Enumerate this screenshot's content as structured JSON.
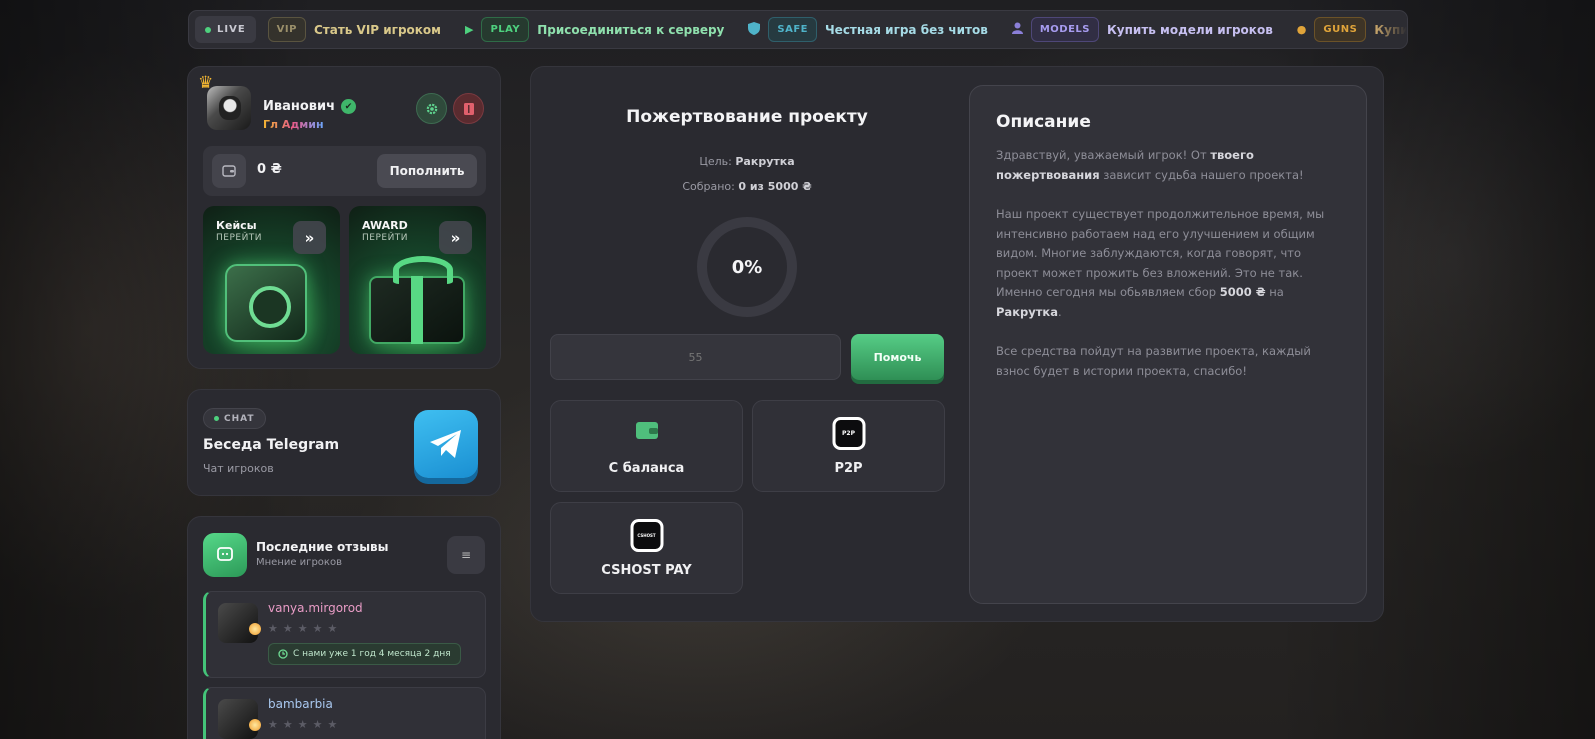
{
  "ticker": {
    "live": "LIVE",
    "items": [
      {
        "tag": "VIP",
        "text": "Стать VIP игроком",
        "tag_color": "#9a8f6a",
        "icon": "none"
      },
      {
        "tag": "PLAY",
        "text": "Присоединиться к серверу",
        "tag_color": "#4ed17e",
        "icon": "play-icon"
      },
      {
        "tag": "SAFE",
        "text": "Честная игра без читов",
        "tag_color": "#4fb3c9",
        "icon": "shield-icon"
      },
      {
        "tag": "MODELS",
        "text": "Купить модели игроков",
        "tag_color": "#8b7fd8",
        "icon": "user-icon"
      },
      {
        "tag": "GUNS",
        "text": "Купить модели оружия",
        "tag_color": "#e0a43a",
        "icon": "gun-icon"
      }
    ]
  },
  "profile": {
    "name": "Иванович",
    "role": "Гл Админ",
    "balance": "0 ₴",
    "topup_label": "Пополнить",
    "cases": {
      "title": "Кейсы",
      "sub": "ПЕРЕЙТИ"
    },
    "award": {
      "title": "AWARD",
      "sub": "ПЕРЕЙТИ"
    }
  },
  "telegram": {
    "pill": "CHAT",
    "title": "Беседа Telegram",
    "sub": "Чат игроков"
  },
  "reviews": {
    "title": "Последние отзывы",
    "sub": "Мнение игроков",
    "items": [
      {
        "name": "vanya.mirgorod",
        "stars": "★★★★★",
        "since": "С нами уже 1 год 4 месяца 2 дня",
        "name_color": "#e99cc6"
      },
      {
        "name": "bambarbia",
        "stars": "★★★★★",
        "since": "",
        "name_color": "#a9c8f0"
      }
    ]
  },
  "donate": {
    "title": "Пожертвование проекту",
    "goal_label": "Цель:",
    "goal_value": "Ракрутка",
    "collected_label": "Собрано:",
    "collected_value": "0 из 5000 ₴",
    "percent": "0%",
    "progress": 0,
    "amount_placeholder": "55",
    "help_label": "Помочь",
    "methods": [
      {
        "label": "С баланса",
        "icon": "wallet-icon"
      },
      {
        "label": "P2P",
        "icon": "p2p-logo"
      },
      {
        "label": "CSHOST PAY",
        "icon": "cshost-logo"
      }
    ],
    "p2p_logo_text": "P2P",
    "cshost_logo_text": "CSHOST"
  },
  "description": {
    "title": "Описание",
    "p1_a": "Здравствуй, уважаемый игрок! От ",
    "p1_b": "твоего пожертвования",
    "p1_c": " зависит судьба нашего проекта!",
    "p2_a": "Наш проект существует продолжительное время, мы интенсивно работаем над его улучшением и общим видом. Многие заблуждаются, когда говорят, что проект может прожить без вложений. Это не так. Именно сегодня мы обьявляем сбор ",
    "p2_b": "5000 ₴",
    "p2_c": " на ",
    "p2_d": "Ракрутка",
    "p2_e": ".",
    "p3": "Все средства пойдут на развитие проекта, каждый взнос будет в истории проекта, спасибо!"
  },
  "colors": {
    "accent": "#4ed17e",
    "panel": "#2a2a30",
    "danger": "#7a3a40"
  }
}
